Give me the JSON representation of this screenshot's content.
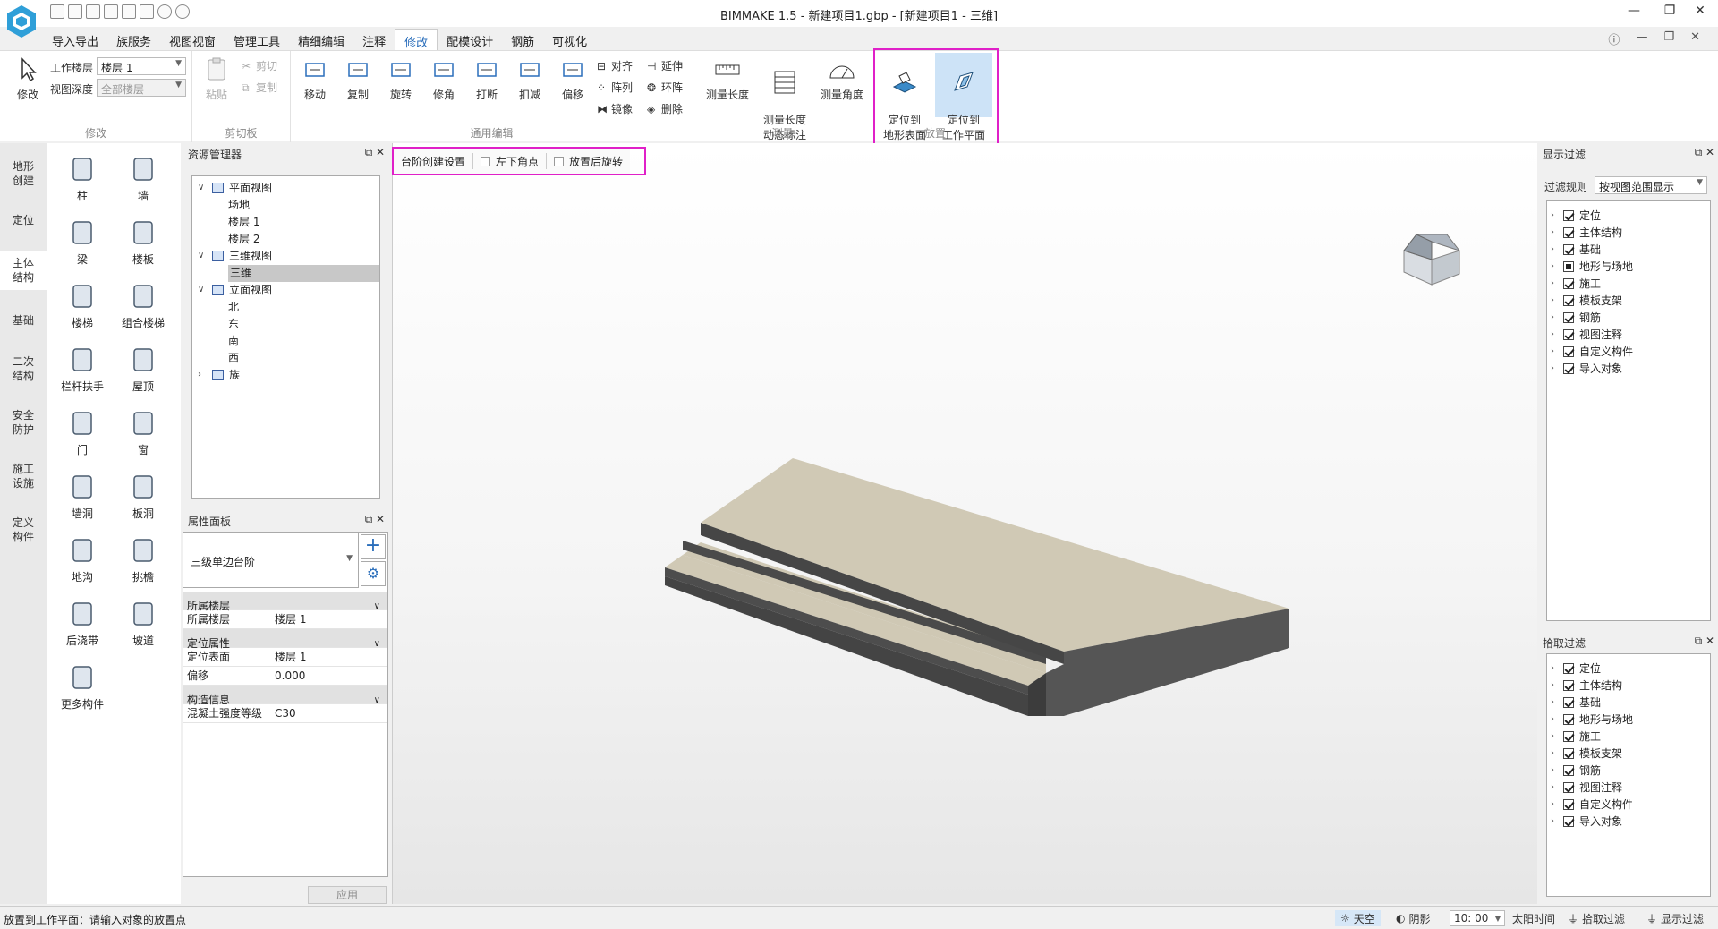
{
  "window": {
    "title": "BIMMAKE 1.5 - 新建项目1.gbp - [新建项目1 - 三维]"
  },
  "menu": {
    "tabs": [
      "导入导出",
      "族服务",
      "视图视窗",
      "管理工具",
      "精细编辑",
      "注释",
      "修改",
      "配模设计",
      "钢筋",
      "可视化"
    ],
    "active": "修改"
  },
  "ribbon": {
    "modify_group": {
      "title": "修改",
      "modify_label": "修改",
      "floor_label": "工作楼层",
      "floor_value": "楼层 1",
      "depth_label": "视图深度",
      "depth_value": "全部楼层"
    },
    "clipboard_group": {
      "title": "剪切板",
      "paste": "粘贴",
      "cut": "剪切",
      "copy": "复制"
    },
    "edit_group": {
      "title": "通用编辑",
      "buttons": [
        "移动",
        "复制",
        "旋转",
        "修角",
        "打断",
        "扣减",
        "偏移"
      ],
      "small": [
        "对齐",
        "延伸",
        "阵列",
        "环阵",
        "镜像",
        "删除"
      ]
    },
    "measure_group": {
      "title": "测量",
      "buttons": [
        "测量长度",
        "测量长度\n动态标注",
        "测量角度"
      ]
    },
    "place_group": {
      "title": "放置",
      "terrain": "定位到\n地形表面",
      "workplane": "定位到\n工作平面"
    }
  },
  "categories": [
    "地形\n创建",
    "定位",
    "主体\n结构",
    "基础",
    "二次\n结构",
    "安全\n防护",
    "施工\n设施",
    "定义\n构件"
  ],
  "active_category": "主体\n结构",
  "components": [
    "柱",
    "墙",
    "梁",
    "楼板",
    "楼梯",
    "组合楼梯",
    "栏杆扶手",
    "屋顶",
    "门",
    "窗",
    "墙洞",
    "板洞",
    "地沟",
    "挑檐",
    "后浇带",
    "坡道",
    "更多构件"
  ],
  "resource_manager": {
    "title": "资源管理器",
    "tree": [
      {
        "label": "平面视图",
        "level": 0,
        "expanded": true,
        "icon": "plan-view-icon"
      },
      {
        "label": "场地",
        "level": 1
      },
      {
        "label": "楼层 1",
        "level": 1
      },
      {
        "label": "楼层 2",
        "level": 1
      },
      {
        "label": "三维视图",
        "level": 0,
        "expanded": true,
        "icon": "3d-view-icon"
      },
      {
        "label": "三维",
        "level": 1,
        "selected": true
      },
      {
        "label": "立面视图",
        "level": 0,
        "expanded": true,
        "icon": "elevation-view-icon"
      },
      {
        "label": "北",
        "level": 1
      },
      {
        "label": "东",
        "level": 1
      },
      {
        "label": "南",
        "level": 1
      },
      {
        "label": "西",
        "level": 1
      },
      {
        "label": "族",
        "level": 0,
        "expanded": false,
        "icon": "family-icon"
      }
    ]
  },
  "properties": {
    "title": "属性面板",
    "type_name": "三级单边台阶",
    "rows": [
      {
        "kind": "category",
        "label": "所属楼层"
      },
      {
        "kind": "prop",
        "label": "所属楼层",
        "value": "楼层 1"
      },
      {
        "kind": "category",
        "label": "定位属性"
      },
      {
        "kind": "prop",
        "label": "定位表面",
        "value": "楼层 1"
      },
      {
        "kind": "prop",
        "label": "偏移",
        "value": "0.000"
      },
      {
        "kind": "category",
        "label": "构造信息"
      },
      {
        "kind": "prop",
        "label": "混凝土强度等级",
        "value": "C30"
      }
    ],
    "apply": "应用"
  },
  "options_bar": {
    "settings": "台阶创建设置",
    "corner": "左下角点",
    "rotate": "放置后旋转"
  },
  "display_filter": {
    "title": "显示过滤",
    "rule_label": "过滤规则",
    "rule_value": "按视图范围显示",
    "items": [
      {
        "label": "定位",
        "state": "on"
      },
      {
        "label": "主体结构",
        "state": "on"
      },
      {
        "label": "基础",
        "state": "on"
      },
      {
        "label": "地形与场地",
        "state": "partial"
      },
      {
        "label": "施工",
        "state": "on"
      },
      {
        "label": "模板支架",
        "state": "on"
      },
      {
        "label": "钢筋",
        "state": "on"
      },
      {
        "label": "视图注释",
        "state": "on"
      },
      {
        "label": "自定义构件",
        "state": "on"
      },
      {
        "label": "导入对象",
        "state": "on"
      }
    ]
  },
  "pick_filter": {
    "title": "拾取过滤",
    "items": [
      {
        "label": "定位",
        "state": "on"
      },
      {
        "label": "主体结构",
        "state": "on"
      },
      {
        "label": "基础",
        "state": "on"
      },
      {
        "label": "地形与场地",
        "state": "on"
      },
      {
        "label": "施工",
        "state": "on"
      },
      {
        "label": "模板支架",
        "state": "on"
      },
      {
        "label": "钢筋",
        "state": "on"
      },
      {
        "label": "视图注释",
        "state": "on"
      },
      {
        "label": "自定义构件",
        "state": "on"
      },
      {
        "label": "导入对象",
        "state": "on"
      }
    ]
  },
  "status": {
    "message": "放置到工作平面：请输入对象的放置点",
    "sky": "天空",
    "shadow": "阴影",
    "time": "10: 00",
    "sun": "太阳时间",
    "pick": "拾取过滤",
    "display": "显示过滤"
  },
  "colors": {
    "accent": "#2a6ebb",
    "highlight": "#e020c8",
    "slab_top": "#cfc8b4",
    "slab_side": "#4a4a4a"
  }
}
